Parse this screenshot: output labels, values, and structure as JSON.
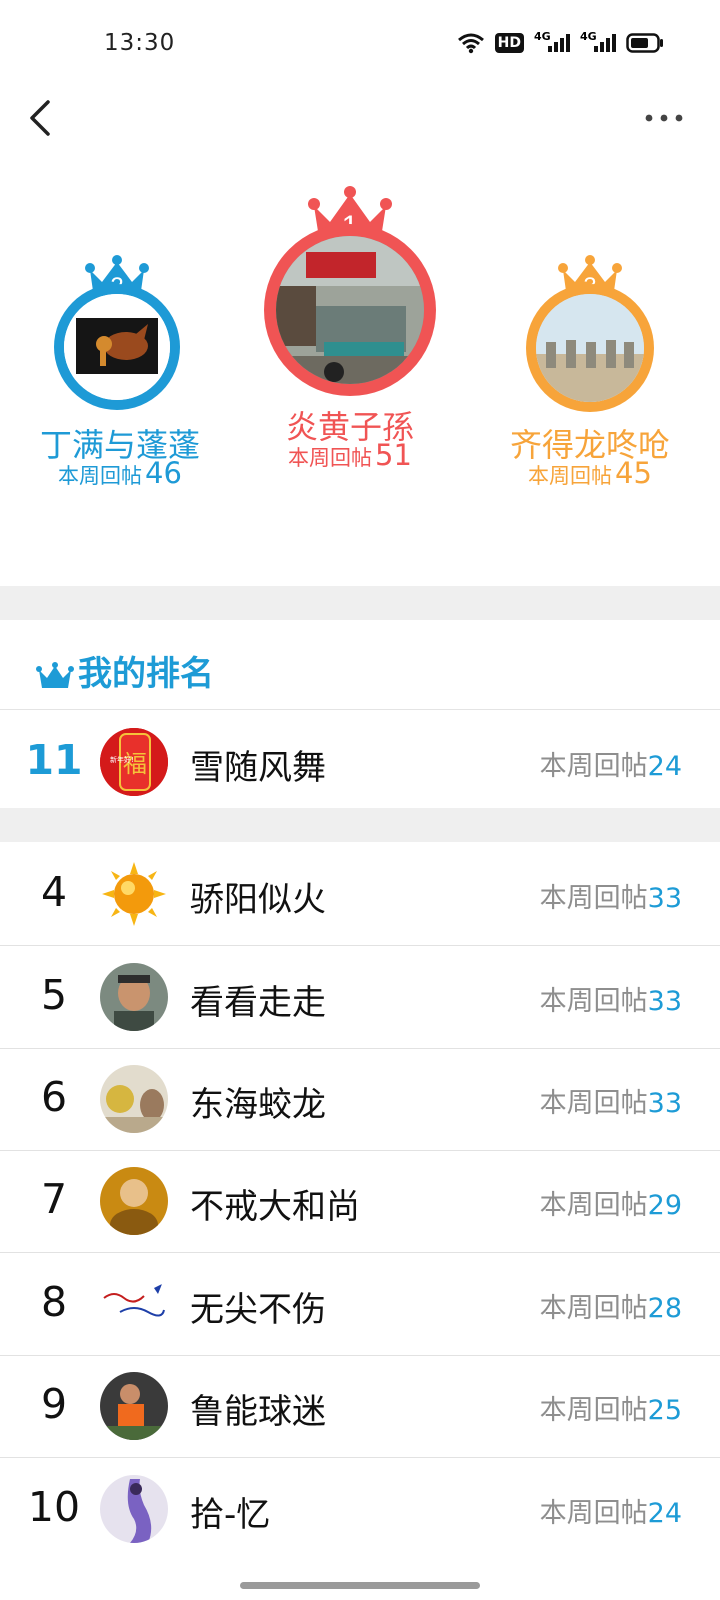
{
  "status_bar": {
    "time": "13:30",
    "icons": [
      "wifi-icon",
      "hd-icon",
      "signal-4g-icon",
      "signal-4g-icon",
      "battery-icon"
    ],
    "hd_label": "HD",
    "network_label": "4G"
  },
  "nav": {
    "back_icon": "chevron-left-icon",
    "more_icon": "more-horizontal-icon"
  },
  "podium": [
    {
      "rank": "2",
      "name": "丁满与蓬蓬",
      "count_label": "本周回帖",
      "count": "46",
      "color": "#1e9ad6"
    },
    {
      "rank": "1",
      "name": "炎黄子孫",
      "count_label": "本周回帖",
      "count": "51",
      "color": "#f05454"
    },
    {
      "rank": "3",
      "name": "齐得龙咚呛",
      "count_label": "本周回帖",
      "count": "45",
      "color": "#f7a43a"
    }
  ],
  "my_rank": {
    "title": "我的排名",
    "icon": "crown-icon",
    "rank": "11",
    "name": "雪随风舞",
    "count_label": "本周回帖",
    "count": "24",
    "avatar_text": "福",
    "avatar_caption": "新年好!"
  },
  "rank_list": [
    {
      "rank": "4",
      "name": "骄阳似火",
      "count_label": "本周回帖",
      "count": "33"
    },
    {
      "rank": "5",
      "name": "看看走走",
      "count_label": "本周回帖",
      "count": "33"
    },
    {
      "rank": "6",
      "name": "东海蛟龙",
      "count_label": "本周回帖",
      "count": "33"
    },
    {
      "rank": "7",
      "name": "不戒大和尚",
      "count_label": "本周回帖",
      "count": "29"
    },
    {
      "rank": "8",
      "name": "无尖不伤",
      "count_label": "本周回帖",
      "count": "28"
    },
    {
      "rank": "9",
      "name": "鲁能球迷",
      "count_label": "本周回帖",
      "count": "25"
    },
    {
      "rank": "10",
      "name": "拾-忆",
      "count_label": "本周回帖",
      "count": "24"
    }
  ],
  "colors": {
    "accent_blue": "#1d9bd6",
    "gold_red": "#f05454",
    "bronze_orange": "#f7a43a",
    "muted_text": "#8e8e8e"
  }
}
